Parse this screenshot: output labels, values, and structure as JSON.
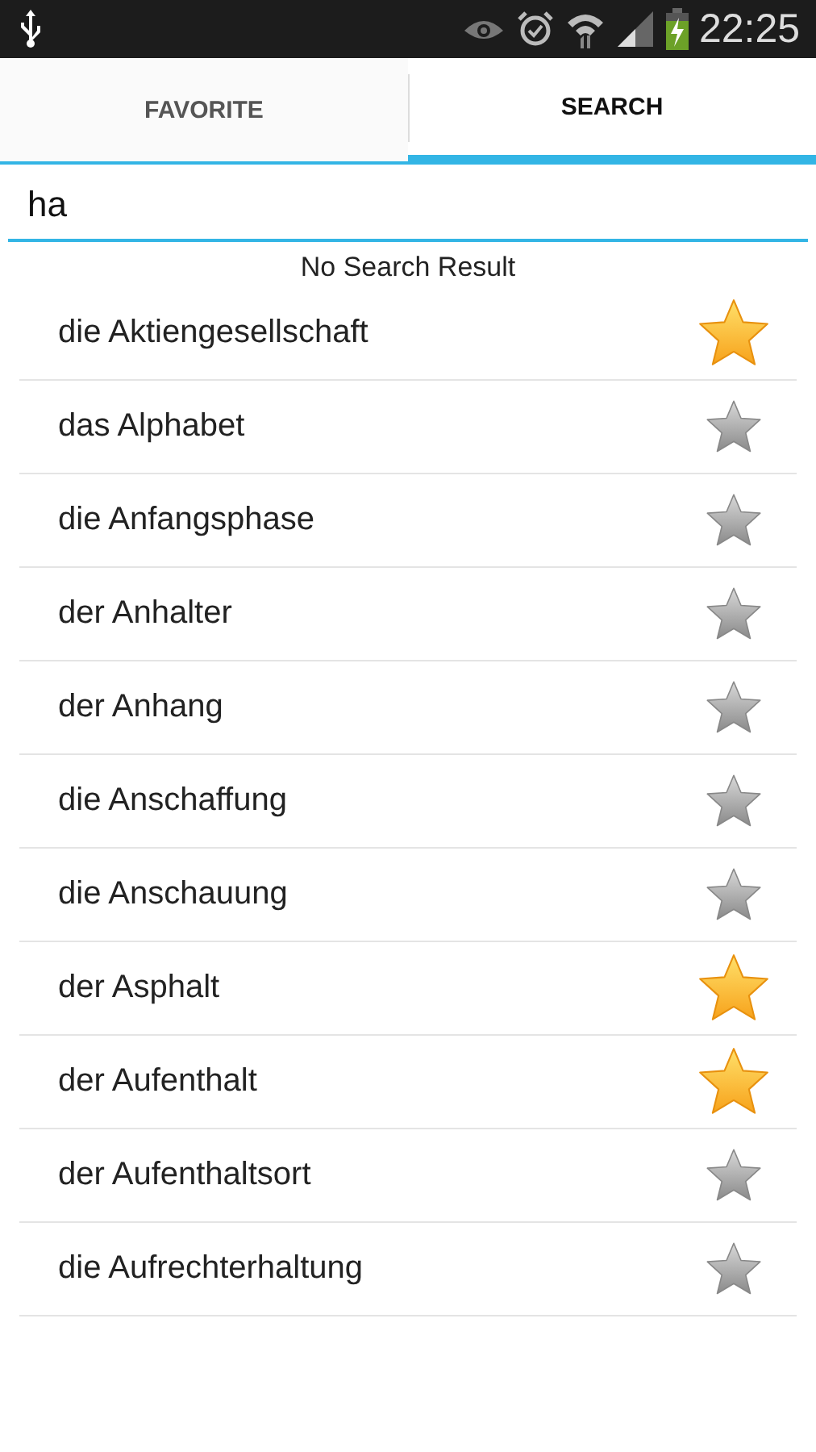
{
  "status_bar": {
    "time": "22:25"
  },
  "tabs": [
    {
      "label": "FAVORITE",
      "selected": false
    },
    {
      "label": "SEARCH",
      "selected": true
    }
  ],
  "search": {
    "value": "ha"
  },
  "message": "No Search Result",
  "rows": [
    {
      "word": "die Aktiengesellschaft",
      "favorite": true
    },
    {
      "word": "das Alphabet",
      "favorite": false
    },
    {
      "word": "die Anfangsphase",
      "favorite": false
    },
    {
      "word": "der Anhalter",
      "favorite": false
    },
    {
      "word": "der Anhang",
      "favorite": false
    },
    {
      "word": "die Anschaffung",
      "favorite": false
    },
    {
      "word": "die Anschauung",
      "favorite": false
    },
    {
      "word": "der Asphalt",
      "favorite": true
    },
    {
      "word": "der Aufenthalt",
      "favorite": true
    },
    {
      "word": "der Aufenthaltsort",
      "favorite": false
    },
    {
      "word": "die Aufrechterhaltung",
      "favorite": false
    }
  ]
}
